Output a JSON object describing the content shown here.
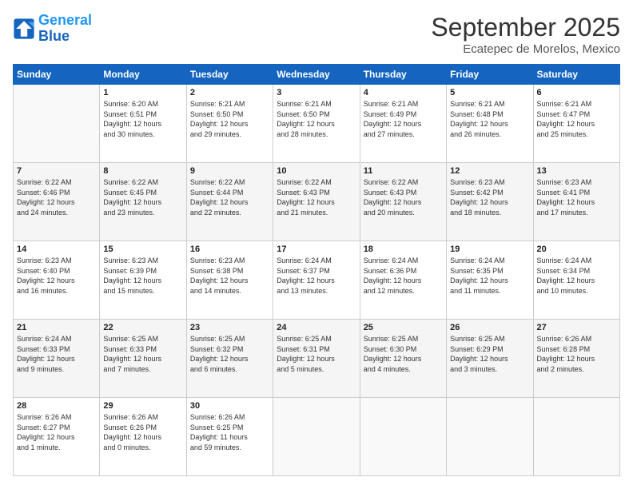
{
  "logo": {
    "line1": "General",
    "line2": "Blue"
  },
  "header": {
    "month": "September 2025",
    "location": "Ecatepec de Morelos, Mexico"
  },
  "days_of_week": [
    "Sunday",
    "Monday",
    "Tuesday",
    "Wednesday",
    "Thursday",
    "Friday",
    "Saturday"
  ],
  "weeks": [
    [
      {
        "day": "",
        "info": ""
      },
      {
        "day": "1",
        "info": "Sunrise: 6:20 AM\nSunset: 6:51 PM\nDaylight: 12 hours\nand 30 minutes."
      },
      {
        "day": "2",
        "info": "Sunrise: 6:21 AM\nSunset: 6:50 PM\nDaylight: 12 hours\nand 29 minutes."
      },
      {
        "day": "3",
        "info": "Sunrise: 6:21 AM\nSunset: 6:50 PM\nDaylight: 12 hours\nand 28 minutes."
      },
      {
        "day": "4",
        "info": "Sunrise: 6:21 AM\nSunset: 6:49 PM\nDaylight: 12 hours\nand 27 minutes."
      },
      {
        "day": "5",
        "info": "Sunrise: 6:21 AM\nSunset: 6:48 PM\nDaylight: 12 hours\nand 26 minutes."
      },
      {
        "day": "6",
        "info": "Sunrise: 6:21 AM\nSunset: 6:47 PM\nDaylight: 12 hours\nand 25 minutes."
      }
    ],
    [
      {
        "day": "7",
        "info": "Sunrise: 6:22 AM\nSunset: 6:46 PM\nDaylight: 12 hours\nand 24 minutes."
      },
      {
        "day": "8",
        "info": "Sunrise: 6:22 AM\nSunset: 6:45 PM\nDaylight: 12 hours\nand 23 minutes."
      },
      {
        "day": "9",
        "info": "Sunrise: 6:22 AM\nSunset: 6:44 PM\nDaylight: 12 hours\nand 22 minutes."
      },
      {
        "day": "10",
        "info": "Sunrise: 6:22 AM\nSunset: 6:43 PM\nDaylight: 12 hours\nand 21 minutes."
      },
      {
        "day": "11",
        "info": "Sunrise: 6:22 AM\nSunset: 6:43 PM\nDaylight: 12 hours\nand 20 minutes."
      },
      {
        "day": "12",
        "info": "Sunrise: 6:23 AM\nSunset: 6:42 PM\nDaylight: 12 hours\nand 18 minutes."
      },
      {
        "day": "13",
        "info": "Sunrise: 6:23 AM\nSunset: 6:41 PM\nDaylight: 12 hours\nand 17 minutes."
      }
    ],
    [
      {
        "day": "14",
        "info": "Sunrise: 6:23 AM\nSunset: 6:40 PM\nDaylight: 12 hours\nand 16 minutes."
      },
      {
        "day": "15",
        "info": "Sunrise: 6:23 AM\nSunset: 6:39 PM\nDaylight: 12 hours\nand 15 minutes."
      },
      {
        "day": "16",
        "info": "Sunrise: 6:23 AM\nSunset: 6:38 PM\nDaylight: 12 hours\nand 14 minutes."
      },
      {
        "day": "17",
        "info": "Sunrise: 6:24 AM\nSunset: 6:37 PM\nDaylight: 12 hours\nand 13 minutes."
      },
      {
        "day": "18",
        "info": "Sunrise: 6:24 AM\nSunset: 6:36 PM\nDaylight: 12 hours\nand 12 minutes."
      },
      {
        "day": "19",
        "info": "Sunrise: 6:24 AM\nSunset: 6:35 PM\nDaylight: 12 hours\nand 11 minutes."
      },
      {
        "day": "20",
        "info": "Sunrise: 6:24 AM\nSunset: 6:34 PM\nDaylight: 12 hours\nand 10 minutes."
      }
    ],
    [
      {
        "day": "21",
        "info": "Sunrise: 6:24 AM\nSunset: 6:33 PM\nDaylight: 12 hours\nand 9 minutes."
      },
      {
        "day": "22",
        "info": "Sunrise: 6:25 AM\nSunset: 6:33 PM\nDaylight: 12 hours\nand 7 minutes."
      },
      {
        "day": "23",
        "info": "Sunrise: 6:25 AM\nSunset: 6:32 PM\nDaylight: 12 hours\nand 6 minutes."
      },
      {
        "day": "24",
        "info": "Sunrise: 6:25 AM\nSunset: 6:31 PM\nDaylight: 12 hours\nand 5 minutes."
      },
      {
        "day": "25",
        "info": "Sunrise: 6:25 AM\nSunset: 6:30 PM\nDaylight: 12 hours\nand 4 minutes."
      },
      {
        "day": "26",
        "info": "Sunrise: 6:25 AM\nSunset: 6:29 PM\nDaylight: 12 hours\nand 3 minutes."
      },
      {
        "day": "27",
        "info": "Sunrise: 6:26 AM\nSunset: 6:28 PM\nDaylight: 12 hours\nand 2 minutes."
      }
    ],
    [
      {
        "day": "28",
        "info": "Sunrise: 6:26 AM\nSunset: 6:27 PM\nDaylight: 12 hours\nand 1 minute."
      },
      {
        "day": "29",
        "info": "Sunrise: 6:26 AM\nSunset: 6:26 PM\nDaylight: 12 hours\nand 0 minutes."
      },
      {
        "day": "30",
        "info": "Sunrise: 6:26 AM\nSunset: 6:25 PM\nDaylight: 11 hours\nand 59 minutes."
      },
      {
        "day": "",
        "info": ""
      },
      {
        "day": "",
        "info": ""
      },
      {
        "day": "",
        "info": ""
      },
      {
        "day": "",
        "info": ""
      }
    ]
  ]
}
